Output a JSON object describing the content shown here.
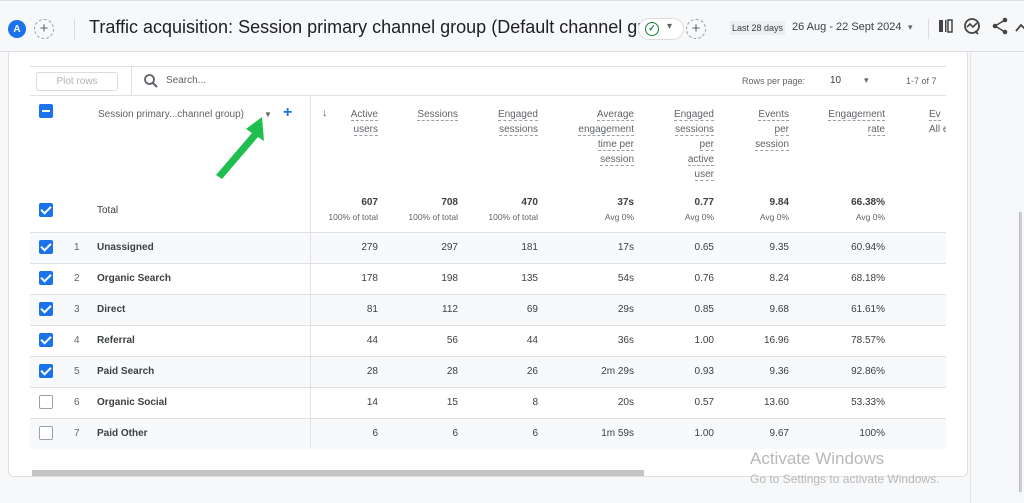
{
  "header": {
    "avatar_letter": "A",
    "title": "Traffic acquisition: Session primary channel group (Default channel group)",
    "date_range_label": "Last 28 days",
    "date_range": "26 Aug - 22 Sept 2024",
    "icons": [
      "customize-report-icon",
      "insights-icon",
      "share-icon",
      "more-icon"
    ]
  },
  "toolbar": {
    "plot_rows_label": "Plot rows",
    "search_placeholder": "Search...",
    "rows_per_page_label": "Rows per page:",
    "rows_per_page_value": "10",
    "pagination": "1-7 of 7"
  },
  "table": {
    "dimension_header": "Session primary...channel group)",
    "total_label": "Total",
    "columns": [
      {
        "label_lines": [
          "Active",
          "users"
        ],
        "total": "607",
        "sub": "100% of total"
      },
      {
        "label_lines": [
          "Sessions"
        ],
        "total": "708",
        "sub": "100% of total"
      },
      {
        "label_lines": [
          "Engaged",
          "sessions"
        ],
        "total": "470",
        "sub": "100% of total"
      },
      {
        "label_lines": [
          "Average",
          "engagement",
          "time per",
          "session"
        ],
        "total": "37s",
        "sub": "Avg 0%"
      },
      {
        "label_lines": [
          "Engaged",
          "sessions",
          "per",
          "active",
          "user"
        ],
        "total": "0.77",
        "sub": "Avg 0%"
      },
      {
        "label_lines": [
          "Events",
          "per",
          "session"
        ],
        "total": "9.84",
        "sub": "Avg 0%"
      },
      {
        "label_lines": [
          "Engagement",
          "rate"
        ],
        "total": "66.38%",
        "sub": "Avg 0%"
      },
      {
        "label_lines": [
          "Ev",
          "All e"
        ],
        "total": "",
        "sub": ""
      }
    ],
    "rows": [
      {
        "num": "1",
        "name": "Unassigned",
        "checked": true,
        "values": [
          "279",
          "297",
          "181",
          "17s",
          "0.65",
          "9.35",
          "60.94%"
        ]
      },
      {
        "num": "2",
        "name": "Organic Search",
        "checked": true,
        "values": [
          "178",
          "198",
          "135",
          "54s",
          "0.76",
          "8.24",
          "68.18%"
        ]
      },
      {
        "num": "3",
        "name": "Direct",
        "checked": true,
        "values": [
          "81",
          "112",
          "69",
          "29s",
          "0.85",
          "9.68",
          "61.61%"
        ]
      },
      {
        "num": "4",
        "name": "Referral",
        "checked": true,
        "values": [
          "44",
          "56",
          "44",
          "36s",
          "1.00",
          "16.96",
          "78.57%"
        ]
      },
      {
        "num": "5",
        "name": "Paid Search",
        "checked": true,
        "values": [
          "28",
          "28",
          "26",
          "2m 29s",
          "0.93",
          "9.36",
          "92.86%"
        ]
      },
      {
        "num": "6",
        "name": "Organic Social",
        "checked": false,
        "values": [
          "14",
          "15",
          "8",
          "20s",
          "0.57",
          "13.60",
          "53.33%"
        ]
      },
      {
        "num": "7",
        "name": "Paid Other",
        "checked": false,
        "values": [
          "6",
          "6",
          "6",
          "1m 59s",
          "1.00",
          "9.67",
          "100%"
        ]
      }
    ]
  },
  "watermark": {
    "line1": "Activate Windows",
    "line2": "Go to Settings to activate Windows."
  },
  "colors": {
    "accent": "#1a73e8",
    "annotation_arrow": "#1fbf4f",
    "check_ok": "#188038"
  }
}
